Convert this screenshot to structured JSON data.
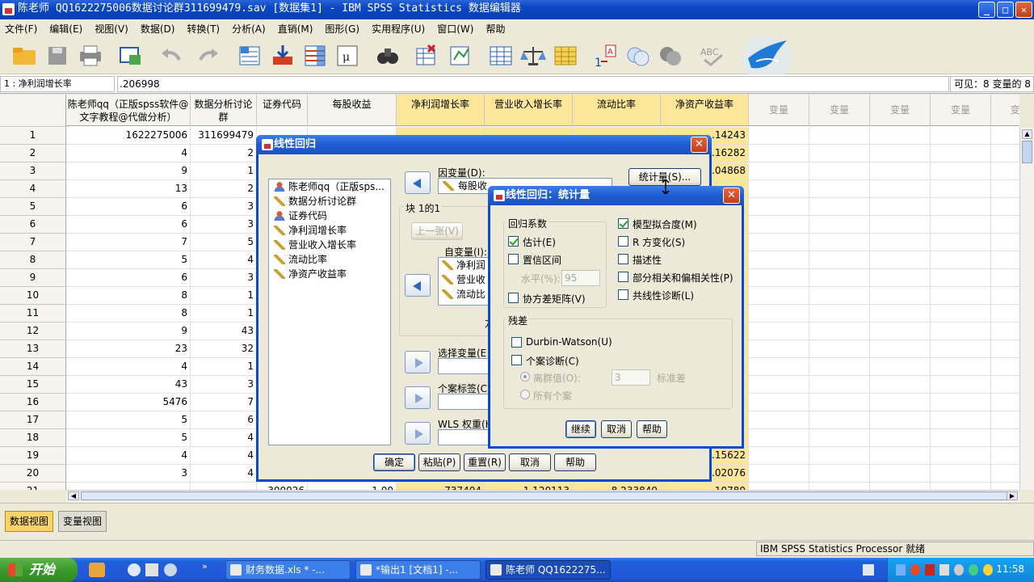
{
  "window": {
    "title": "陈老师 QQ1622275006数据讨论群311699479.sav [数据集1] - IBM SPSS Statistics 数据编辑器"
  },
  "menu": [
    "文件(F)",
    "编辑(E)",
    "视图(V)",
    "数据(D)",
    "转换(T)",
    "分析(A)",
    "直销(M)",
    "图形(G)",
    "实用程序(U)",
    "窗口(W)",
    "帮助"
  ],
  "cellbar": {
    "ref": "1 : 净利润增长率",
    "value": ".206998",
    "visible": "可见：8 变量的 8"
  },
  "grid": {
    "columns": [
      "陈老师qq（正版spss软件@文字教程@代做分析）",
      "数据分析讨论群",
      "证券代码",
      "每股收益",
      "净利润增长率",
      "营业收入增长率",
      "流动比率",
      "净资产收益率"
    ],
    "empty_column_label": "变量",
    "empty_last_label": "变",
    "rows": [
      {
        "n": "1",
        "c1": "1622275006",
        "c2": "311699479",
        "c8": ".14243"
      },
      {
        "n": "2",
        "c1": "4",
        "c2": "2",
        "c8": ".16282"
      },
      {
        "n": "3",
        "c1": "9",
        "c2": "1",
        "c8": ".04868"
      },
      {
        "n": "4",
        "c1": "13",
        "c2": "2",
        "c8": ""
      },
      {
        "n": "5",
        "c1": "6",
        "c2": "3",
        "c8": ""
      },
      {
        "n": "6",
        "c1": "6",
        "c2": "3",
        "c8": ""
      },
      {
        "n": "7",
        "c1": "7",
        "c2": "5",
        "c8": ""
      },
      {
        "n": "8",
        "c1": "5",
        "c2": "4",
        "c8": ""
      },
      {
        "n": "9",
        "c1": "6",
        "c2": "3",
        "c8": ""
      },
      {
        "n": "10",
        "c1": "8",
        "c2": "1",
        "c8": ""
      },
      {
        "n": "11",
        "c1": "8",
        "c2": "1",
        "c8": ""
      },
      {
        "n": "12",
        "c1": "9",
        "c2": "43",
        "c8": ""
      },
      {
        "n": "13",
        "c1": "23",
        "c2": "32",
        "c8": ""
      },
      {
        "n": "14",
        "c1": "4",
        "c2": "1",
        "c8": ""
      },
      {
        "n": "15",
        "c1": "43",
        "c2": "3",
        "c8": ""
      },
      {
        "n": "16",
        "c1": "5476",
        "c2": "7",
        "c8": ""
      },
      {
        "n": "17",
        "c1": "5",
        "c2": "6",
        "c8": ""
      },
      {
        "n": "18",
        "c1": "5",
        "c2": "4",
        "c8": ""
      },
      {
        "n": "19",
        "c1": "4",
        "c2": "4",
        "c8": ".15622"
      },
      {
        "n": "20",
        "c1": "3",
        "c2": "4",
        "c8": ".02076"
      }
    ],
    "partial_row": {
      "n": "21",
      "c3": "300026",
      "c4": "1.00",
      "c5": ".737404",
      "c6": "1.120113",
      "c7": "8.233849",
      "c8": ".10780"
    }
  },
  "tabs": {
    "data_view": "数据视图",
    "variable_view": "变量视图"
  },
  "status": {
    "processor": "IBM SPSS Statistics Processor 就绪"
  },
  "taskbar": {
    "start": "开始",
    "tasks": [
      "财务数据.xls * -...",
      "*输出1 [文档1] -...",
      "陈老师 QQ1622275..."
    ],
    "clock": "11:58"
  },
  "regression_dialog": {
    "title": "线性回归",
    "source_vars": [
      "陈老师qq（正版sps...",
      "数据分析讨论群",
      "证券代码",
      "净利润增长率",
      "营业收入增长率",
      "流动比率",
      "净资产收益率"
    ],
    "dependent_label": "因变量(D):",
    "dependent_value": "每股收",
    "block_label": "块 1的1",
    "prev_button": "上一张(V)",
    "independent_label": "自变量(I):",
    "independent_vars": [
      "净利润",
      "营业收",
      "流动比"
    ],
    "method_fragment": "方",
    "selection_label": "选择变量(E",
    "case_label_label": "个案标签(C",
    "wls_label": "WLS 权重(H",
    "statistics_button": "统计量(S)...",
    "buttons": {
      "ok": "确定",
      "paste": "粘贴(P)",
      "reset": "重置(R)",
      "cancel": "取消",
      "help": "帮助"
    }
  },
  "stats_dialog": {
    "title": "线性回归：统计量",
    "coef_group": "回归系数",
    "estimates": "估计(E)",
    "conf_intervals": "置信区间",
    "level_label": "水平(%):",
    "level_value": "95",
    "cov_matrix": "协方差矩阵(V)",
    "model_fit": "模型拟合度(M)",
    "r2_change": "R 方变化(S)",
    "descriptives": "描述性",
    "part_partial": "部分相关和偏相关性(P)",
    "collinearity": "共线性诊断(L)",
    "residuals_group": "残差",
    "durbin_watson": "Durbin-Watson(U)",
    "casewise": "个案诊断(C)",
    "outliers": "离群值(O):",
    "outlier_value": "3",
    "std_dev": "标准差",
    "all_cases": "所有个案",
    "buttons": {
      "continue": "继续",
      "cancel": "取消",
      "help": "帮助"
    }
  },
  "colors": {
    "accent_yellow": "#fbe69a",
    "titlebar_blue": "#0a46c4"
  }
}
